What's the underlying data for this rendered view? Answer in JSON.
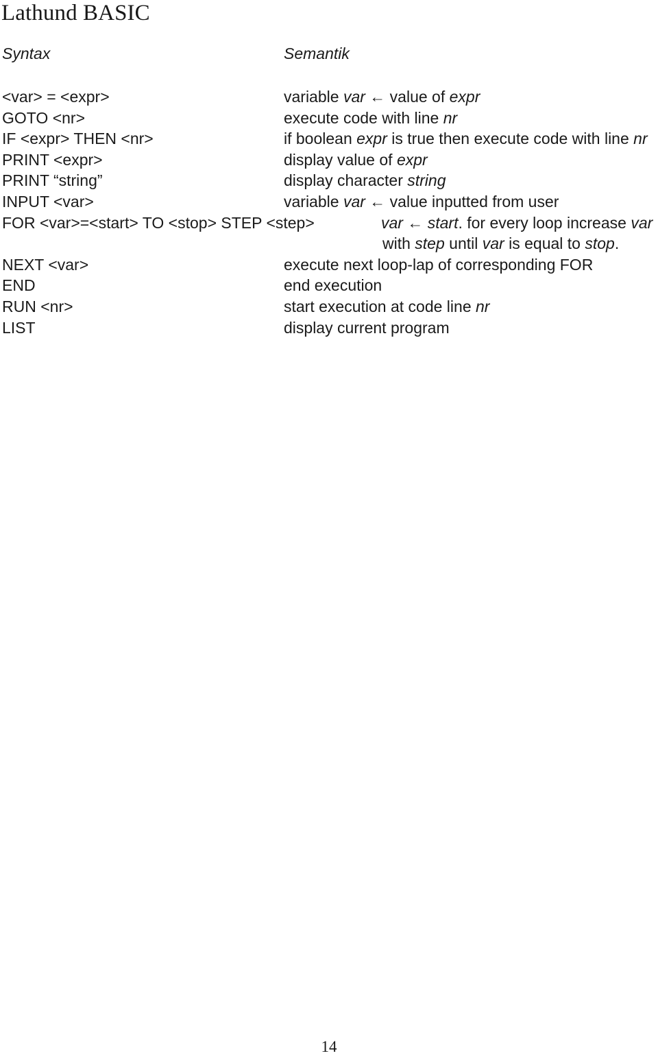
{
  "document": {
    "title": "Lathund BASIC",
    "page_number": "14"
  },
  "table": {
    "headers": {
      "syntax": "Syntax",
      "semantik": "Semantik"
    },
    "rows": [
      {
        "syntax": "<var> = <expr>",
        "semantik_line1_a": "variable ",
        "semantik_line1_i1": "var",
        "semantik_line1_b": " ← value of ",
        "semantik_line1_i2": "expr",
        "semantik_line1_c": "",
        "semantik_plain": "variable var ← value of expr"
      },
      {
        "syntax": "GOTO <nr>",
        "semantik_line1_a": "execute code with line ",
        "semantik_line1_i1": "nr",
        "semantik_line1_b": "",
        "semantik_line1_i2": "",
        "semantik_line1_c": "",
        "semantik_plain": "execute code with line nr"
      },
      {
        "syntax": "IF <expr> THEN <nr>",
        "semantik_line1_a": "if boolean ",
        "semantik_line1_i1": "expr",
        "semantik_line1_b": " is true then execute code with line ",
        "semantik_line1_i2": "nr",
        "semantik_line1_c": "",
        "semantik_plain": "if boolean expr is true then execute code with line nr"
      },
      {
        "syntax": "PRINT <expr>",
        "semantik_line1_a": "display value of ",
        "semantik_line1_i1": "expr",
        "semantik_line1_b": "",
        "semantik_line1_i2": "",
        "semantik_line1_c": "",
        "semantik_plain": "display value of expr"
      },
      {
        "syntax": "PRINT “string”",
        "semantik_line1_a": "display character ",
        "semantik_line1_i1": "string",
        "semantik_line1_b": "",
        "semantik_line1_i2": "",
        "semantik_line1_c": "",
        "semantik_plain": "display character string"
      },
      {
        "syntax": "INPUT <var>",
        "semantik_line1_a": "variable ",
        "semantik_line1_i1": "var",
        "semantik_line1_b": " ← value inputted from user",
        "semantik_line1_i2": "",
        "semantik_line1_c": "",
        "semantik_plain": "variable var ← value inputted from user"
      },
      {
        "syntax": "FOR <var>=<start> TO <stop> STEP <step>",
        "semantik_line1_i1": "var",
        "semantik_line1_arrow": " ← ",
        "semantik_line1_i2": "start",
        "semantik_line1_b": ". for every loop increase ",
        "semantik_line1_i3": "var",
        "semantik_line2_a": "with ",
        "semantik_line2_i1": "step",
        "semantik_line2_b": " until ",
        "semantik_line2_i2": "var",
        "semantik_line2_c": " is equal to ",
        "semantik_line2_i3": "stop",
        "semantik_line2_d": ".",
        "semantik_plain": "var ← start. for every loop increase var with step until var is equal to stop."
      },
      {
        "syntax": "NEXT <var>",
        "semantik_line1_a": "execute next loop-lap of corresponding FOR",
        "semantik_line1_i1": "",
        "semantik_line1_b": "",
        "semantik_line1_i2": "",
        "semantik_line1_c": "",
        "semantik_plain": "execute next loop-lap of corresponding FOR"
      },
      {
        "syntax": "END",
        "semantik_line1_a": "end execution",
        "semantik_line1_i1": "",
        "semantik_line1_b": "",
        "semantik_line1_i2": "",
        "semantik_line1_c": "",
        "semantik_plain": "end execution"
      },
      {
        "syntax": "RUN <nr>",
        "semantik_line1_a": "start execution at code line ",
        "semantik_line1_i1": "nr",
        "semantik_line1_b": "",
        "semantik_line1_i2": "",
        "semantik_line1_c": "",
        "semantik_plain": "start execution at code line nr"
      },
      {
        "syntax": "LIST",
        "semantik_line1_a": "display current program",
        "semantik_line1_i1": "",
        "semantik_line1_b": "",
        "semantik_line1_i2": "",
        "semantik_line1_c": "",
        "semantik_plain": "display current program"
      }
    ]
  }
}
